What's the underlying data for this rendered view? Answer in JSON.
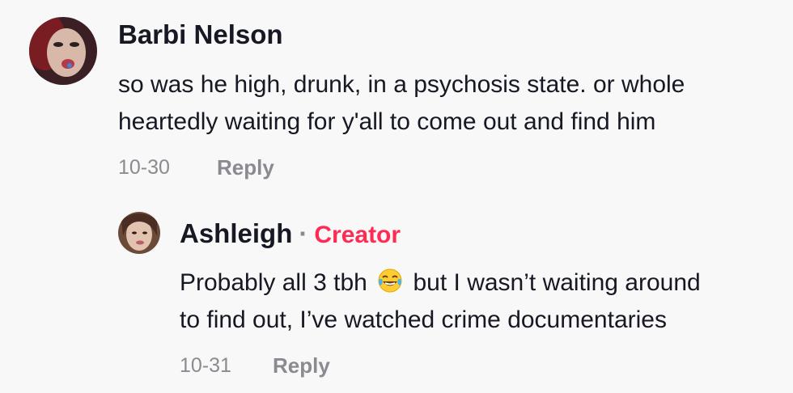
{
  "comments": [
    {
      "username": "Barbi Nelson",
      "text_line1": "so was he high, drunk, in a psychosis state. or whole",
      "text_line2": "heartedly waiting for y'all to come out and find him",
      "date": "10-30",
      "reply_label": "Reply"
    }
  ],
  "reply": {
    "username": "Ashleigh",
    "separator": "·",
    "badge": "Creator",
    "text_line1_before": "Probably all 3 tbh",
    "emoji": "face-with-tears-of-joy-icon",
    "text_line1_after": "but I wasn’t waiting around",
    "text_line2": "to find out, I’ve watched crime documentaries",
    "date": "10-31",
    "reply_label": "Reply"
  },
  "colors": {
    "background": "#f8f8f8",
    "text": "#161823",
    "muted": "#8a8b91",
    "creator_badge": "#fe2c55"
  }
}
